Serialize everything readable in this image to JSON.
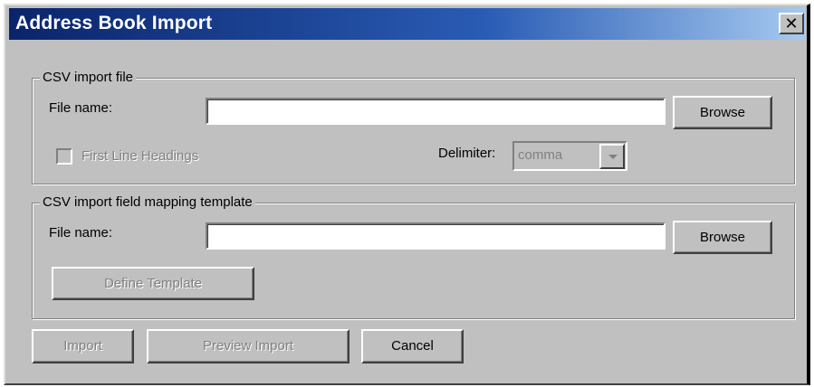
{
  "window": {
    "title": "Address Book Import",
    "close_label": "✕"
  },
  "csv_file": {
    "legend": "CSV import file",
    "file_label": "File name:",
    "file_value": "",
    "browse_label": "Browse",
    "first_line_label": "First Line Headings",
    "first_line_checked": false,
    "delimiter_label": "Delimiter:",
    "delimiter_value": "comma"
  },
  "mapping": {
    "legend": "CSV import field mapping template",
    "file_label": "File name:",
    "file_value": "",
    "browse_label": "Browse",
    "define_label": "Define Template"
  },
  "actions": {
    "import_label": "Import",
    "preview_label": "Preview Import",
    "cancel_label": "Cancel"
  }
}
